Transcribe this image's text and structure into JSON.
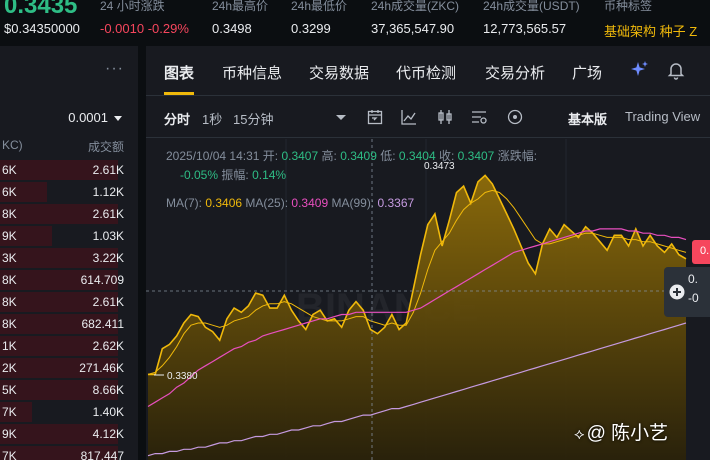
{
  "ticker": {
    "price": "0.3435",
    "price_sub": "$0.34350000",
    "stats": [
      {
        "label": "24 小时涨跌",
        "value": "-0.0010 -0.29%",
        "tone": "red"
      },
      {
        "label": "24h最高价",
        "value": "0.3498",
        "tone": ""
      },
      {
        "label": "24h最低价",
        "value": "0.3299",
        "tone": ""
      },
      {
        "label": "24h成交量(ZKC)",
        "value": "37,365,547.90",
        "tone": ""
      },
      {
        "label": "24h成交量(USDT)",
        "value": "12,773,565.57",
        "tone": ""
      },
      {
        "label": "币种标签",
        "value": "基础架构  种子  Z",
        "tone": "gold"
      }
    ]
  },
  "orderbook": {
    "menu_dots": "···",
    "precision": "0.0001",
    "col_left": "KC)",
    "col_right": "成交额",
    "rows": [
      {
        "p": "6K",
        "q": "2.61K",
        "depth": 0.95
      },
      {
        "p": "6K",
        "q": "1.12K",
        "depth": 0.38
      },
      {
        "p": "8K",
        "q": "2.61K",
        "depth": 0.95
      },
      {
        "p": "9K",
        "q": "1.03K",
        "depth": 0.42
      },
      {
        "p": "3K",
        "q": "3.22K",
        "depth": 0.95
      },
      {
        "p": "8K",
        "q": "614.709",
        "depth": 0.95
      },
      {
        "p": "8K",
        "q": "2.61K",
        "depth": 0.95
      },
      {
        "p": "8K",
        "q": "682.411",
        "depth": 0.95
      },
      {
        "p": "1K",
        "q": "2.62K",
        "depth": 0.95
      },
      {
        "p": "2K",
        "q": "271.46K",
        "depth": 0.95
      },
      {
        "p": "5K",
        "q": "8.66K",
        "depth": 0.95
      },
      {
        "p": "7K",
        "q": "1.40K",
        "depth": 0.26
      },
      {
        "p": "9K",
        "q": "4.12K",
        "depth": 0.95
      },
      {
        "p": "7K",
        "q": "817.447",
        "depth": 0.95
      }
    ]
  },
  "tabs": {
    "items": [
      "图表",
      "币种信息",
      "交易数据",
      "代币检测",
      "交易分析",
      "广场"
    ],
    "active": 0
  },
  "toolbar": {
    "intervals": [
      "分时",
      "1秒",
      "15分钟"
    ],
    "active_interval": 0,
    "mode_basic": "基本版",
    "mode_tv": "Trading View"
  },
  "legend": {
    "datetime": "2025/10/04 14:31",
    "open_label": "开:",
    "open": "0.3407",
    "high_label": "高:",
    "high": "0.3409",
    "low_label": "低:",
    "low": "0.3404",
    "close_label": "收:",
    "close": "0.3407",
    "change_label": "涨跌幅:",
    "change": "-0.05%",
    "amp_label": "振幅:",
    "amp": "0.14%",
    "ma7_label": "MA(7):",
    "ma7": "0.3406",
    "ma25_label": "MA(25):",
    "ma25": "0.3409",
    "ma99_label": "MA(99):",
    "ma99": "0.3367"
  },
  "chart_data": {
    "type": "area",
    "title": "",
    "xlabel": "",
    "ylabel": "",
    "ylim": [
      0.334,
      0.349
    ],
    "annotations": {
      "high_mark": "0.3473",
      "low_mark": "0.3380"
    },
    "series": [
      {
        "name": "Price",
        "color": "#f0b90b",
        "values": [
          0.338,
          0.338,
          0.3392,
          0.3394,
          0.3398,
          0.3404,
          0.3408,
          0.3407,
          0.3402,
          0.34,
          0.3396,
          0.3406,
          0.3411,
          0.3409,
          0.3412,
          0.3418,
          0.3417,
          0.3411,
          0.3411,
          0.3417,
          0.341,
          0.3405,
          0.3401,
          0.3408,
          0.341,
          0.3405,
          0.3406,
          0.3402,
          0.341,
          0.3414,
          0.341,
          0.3401,
          0.3399,
          0.3402,
          0.3408,
          0.3401,
          0.3404,
          0.342,
          0.3436,
          0.345,
          0.3455,
          0.344,
          0.3452,
          0.3465,
          0.3468,
          0.346,
          0.347,
          0.3473,
          0.3469,
          0.3462,
          0.3455,
          0.3448,
          0.344,
          0.3432,
          0.3427,
          0.3441,
          0.3448,
          0.3444,
          0.345,
          0.3447,
          0.3444,
          0.3449,
          0.3446,
          0.3442,
          0.3438,
          0.3445,
          0.3445,
          0.344,
          0.3448,
          0.344,
          0.3445,
          0.344,
          0.3437,
          0.3441,
          0.3436,
          0.3434
        ]
      },
      {
        "name": "MA(7)",
        "color": "#f0b90b",
        "values": [
          0.338,
          0.3381,
          0.3384,
          0.3388,
          0.3393,
          0.3399,
          0.3403,
          0.3404,
          0.3404,
          0.3403,
          0.3402,
          0.3403,
          0.3405,
          0.3406,
          0.3407,
          0.341,
          0.3412,
          0.3413,
          0.3413,
          0.3414,
          0.3413,
          0.3411,
          0.3409,
          0.3407,
          0.3406,
          0.3405,
          0.3405,
          0.3405,
          0.3406,
          0.3407,
          0.3407,
          0.3405,
          0.3404,
          0.3403,
          0.3404,
          0.3403,
          0.3403,
          0.3409,
          0.3418,
          0.3429,
          0.3438,
          0.3442,
          0.3446,
          0.3452,
          0.3457,
          0.346,
          0.3462,
          0.3465,
          0.3466,
          0.3465,
          0.3462,
          0.3458,
          0.3453,
          0.3448,
          0.3443,
          0.3441,
          0.3441,
          0.3442,
          0.3443,
          0.3444,
          0.3445,
          0.3446,
          0.3446,
          0.3445,
          0.3444,
          0.3444,
          0.3444,
          0.3443,
          0.3443,
          0.3442,
          0.3442,
          0.3441,
          0.344,
          0.3439,
          0.3438,
          0.3437
        ]
      },
      {
        "name": "MA(25)",
        "color": "#e84fbf",
        "values": [
          0.3365,
          0.3367,
          0.3369,
          0.3371,
          0.3374,
          0.3376,
          0.3379,
          0.3382,
          0.3384,
          0.3386,
          0.3388,
          0.339,
          0.3392,
          0.3393,
          0.3395,
          0.3396,
          0.3398,
          0.3399,
          0.34,
          0.3401,
          0.3402,
          0.3403,
          0.3404,
          0.3405,
          0.3406,
          0.3406,
          0.3407,
          0.3408,
          0.3408,
          0.3409,
          0.3409,
          0.3409,
          0.3409,
          0.3409,
          0.3409,
          0.3409,
          0.3409,
          0.341,
          0.3411,
          0.3413,
          0.3415,
          0.3417,
          0.3419,
          0.3421,
          0.3423,
          0.3425,
          0.3427,
          0.3429,
          0.3431,
          0.3433,
          0.3435,
          0.3437,
          0.3438,
          0.3439,
          0.344,
          0.3441,
          0.3442,
          0.3443,
          0.3444,
          0.3445,
          0.3446,
          0.3447,
          0.3447,
          0.3448,
          0.3448,
          0.3448,
          0.3448,
          0.3447,
          0.3447,
          0.3446,
          0.3446,
          0.3445,
          0.3445,
          0.3444,
          0.3444,
          0.3443
        ]
      },
      {
        "name": "MA(99)",
        "color": "#c59ae0",
        "values": [
          0.3342,
          0.3343,
          0.3343,
          0.3344,
          0.3344,
          0.3345,
          0.3345,
          0.3346,
          0.3346,
          0.3347,
          0.3348,
          0.3348,
          0.3349,
          0.3349,
          0.335,
          0.3351,
          0.3351,
          0.3352,
          0.3352,
          0.3353,
          0.3354,
          0.3354,
          0.3355,
          0.3356,
          0.3356,
          0.3357,
          0.3358,
          0.3358,
          0.3359,
          0.336,
          0.3361,
          0.3361,
          0.3362,
          0.3363,
          0.3364,
          0.3364,
          0.3365,
          0.3366,
          0.3367,
          0.3368,
          0.3369,
          0.337,
          0.3371,
          0.3372,
          0.3373,
          0.3374,
          0.3375,
          0.3376,
          0.3377,
          0.3378,
          0.3379,
          0.338,
          0.3381,
          0.3382,
          0.3383,
          0.3384,
          0.3385,
          0.3386,
          0.3387,
          0.3388,
          0.3389,
          0.339,
          0.3391,
          0.3392,
          0.3393,
          0.3394,
          0.3395,
          0.3396,
          0.3397,
          0.3398,
          0.3399,
          0.34,
          0.3401,
          0.3402,
          0.3403,
          0.3404
        ]
      }
    ]
  },
  "overlays": {
    "right_tag_text": "0.",
    "crosshair_value_1": "0.",
    "crosshair_value_2": "-0",
    "watermark": "@ 陈小艺"
  },
  "colors": {
    "up": "#2ebd85",
    "down": "#f6465d",
    "accent": "#f0b90b",
    "bg": "#181a20"
  }
}
